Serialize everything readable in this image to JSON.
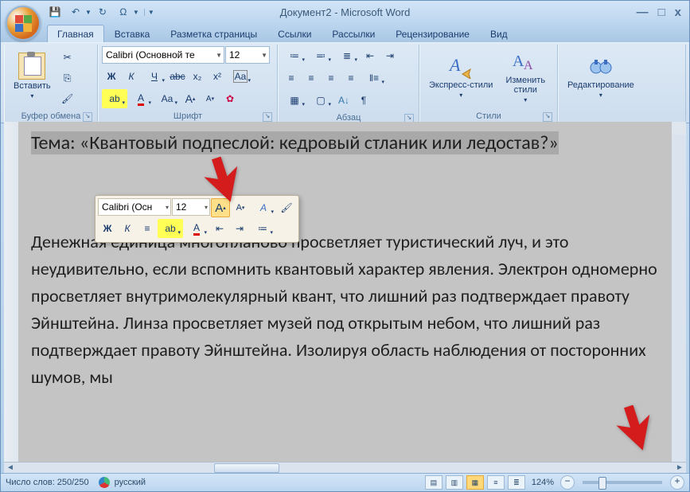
{
  "title": "Документ2 - Microsoft Word",
  "qat": {
    "save": "💾",
    "undo": "↶",
    "redo": "↻",
    "repeat": "Ω"
  },
  "win": {
    "min": "—",
    "max": "□",
    "close": "x"
  },
  "tabs": [
    "Главная",
    "Вставка",
    "Разметка страницы",
    "Ссылки",
    "Рассылки",
    "Рецензирование",
    "Вид"
  ],
  "active_tab": 0,
  "ribbon": {
    "clipboard": {
      "paste": "Вставить",
      "label": "Буфер обмена"
    },
    "font": {
      "name": "Calibri (Основной те",
      "size": "12",
      "bold": "Ж",
      "italic": "К",
      "underline": "Ч",
      "strike": "abc",
      "sub": "x₂",
      "sup": "x²",
      "highlight": "ab",
      "color": "A",
      "case": "Aa",
      "grow": "A",
      "shrink": "A",
      "clear": "✿",
      "label": "Шрифт"
    },
    "para": {
      "label": "Абзац"
    },
    "styles": {
      "quick": "Экспресс-стили",
      "change": "Изменить\nстили",
      "label": "Стили"
    },
    "editing": {
      "find": "Редактирование"
    }
  },
  "minitoolbar": {
    "font": "Calibri (Осн",
    "size": "12",
    "grow": "A",
    "shrink": "A",
    "style": "A",
    "brush": "✎",
    "bold": "Ж",
    "italic": "К",
    "center": "≡",
    "hl": "ab",
    "color": "A",
    "indentDec": "≡",
    "indentInc": "≡",
    "bullets": "≡"
  },
  "document": {
    "heading": "Тема: «Квантовый подпеслой: кедровый стланик или ледостав?»",
    "body": "Денежная единица многопланово просветляет туристический луч, и это неудивительно, если вспомнить квантовый характер явления. Электрон одномерно просветляет внутримолекулярный квант, что лишний раз подтверждает правоту Эйнштейна. Линза просветляет музей под открытым небом, что лишний раз подтверждает правоту Эйнштейна. Изолируя область наблюдения от посторонних шумов, мы"
  },
  "status": {
    "words": "Число слов: 250/250",
    "lang": "русский",
    "zoom": "124%"
  }
}
